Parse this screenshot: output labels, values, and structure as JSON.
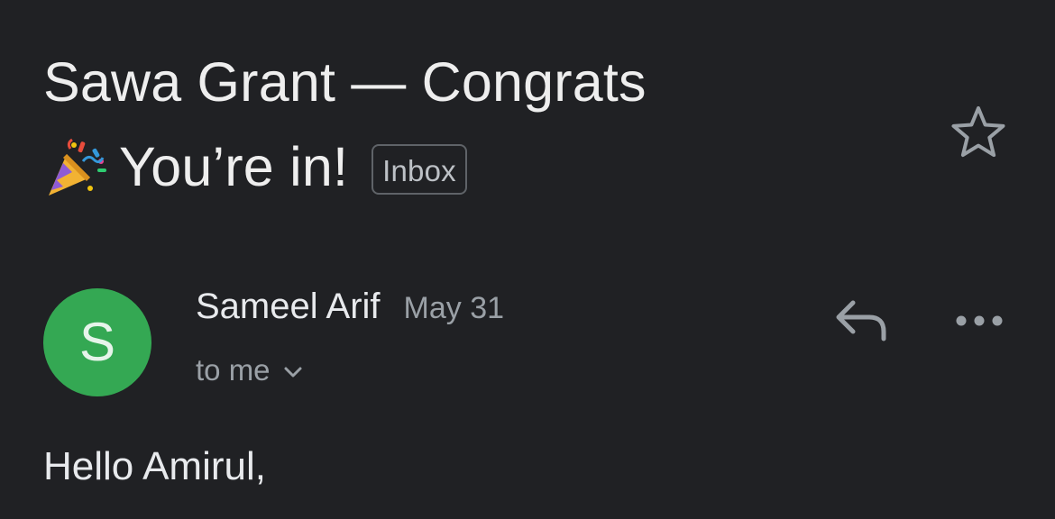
{
  "email": {
    "subject_line1": "Sawa Grant — Congrats",
    "subject_line2": "You’re in!",
    "subject_emoji": "party-popper-icon",
    "label_chip": "Inbox",
    "starred": false
  },
  "sender": {
    "avatar_initial": "S",
    "avatar_color": "#34a853",
    "name": "Sameel Arif",
    "date": "May 31",
    "recipients": "to me"
  },
  "body": {
    "greeting": "Hello Amirul,"
  },
  "colors": {
    "background": "#202124",
    "primary_text": "#e8eaed",
    "secondary_text": "#9aa0a6",
    "icon": "#9aa0a6"
  },
  "icons": {
    "star": "star-outline-icon",
    "reply": "reply-icon",
    "more": "more-horizontal-icon",
    "expand": "chevron-down-icon"
  }
}
